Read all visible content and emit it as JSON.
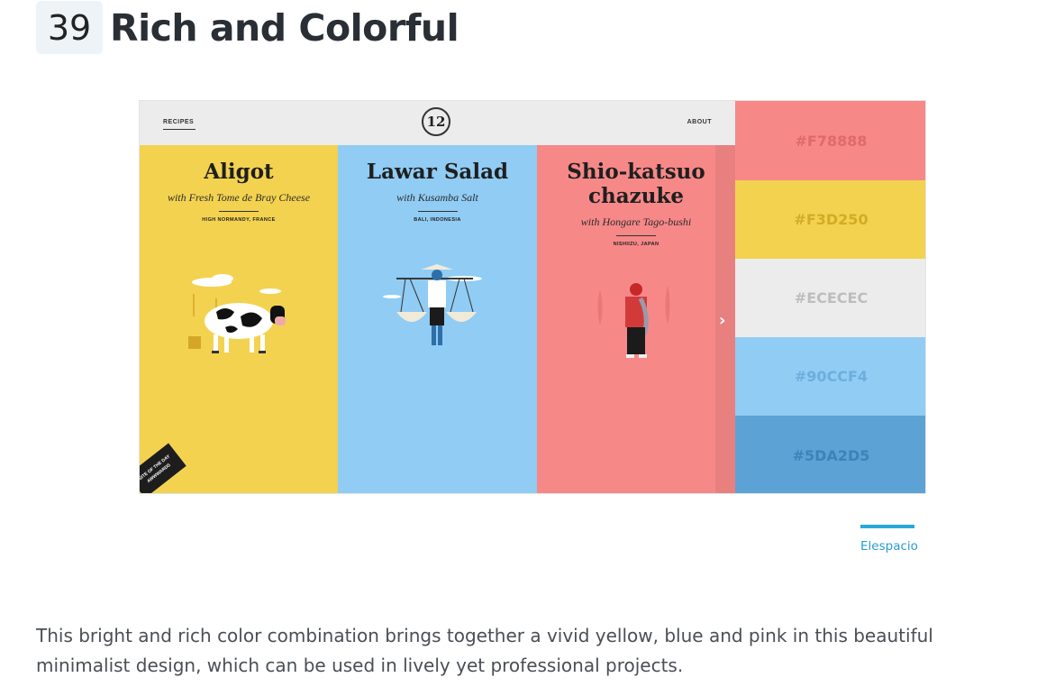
{
  "section": {
    "number": "39",
    "title": "Rich and Colorful"
  },
  "screenshot": {
    "nav": {
      "left": "RECIPES",
      "right": "ABOUT",
      "logo": "12"
    },
    "dishes": [
      {
        "title": "Aligot",
        "subtitle": "with Fresh Tome de Bray Cheese",
        "location": "HIGH NORMANDY, FRANCE",
        "color": "#F3D250"
      },
      {
        "title": "Lawar Salad",
        "subtitle": "with Kusamba Salt",
        "location": "BALI, INDONESIA",
        "color": "#90CCF4"
      },
      {
        "title_line1": "Shio-katsuo",
        "title_line2": "chazuke",
        "subtitle": "with Hongare Tago-bushi",
        "location": "NISHIIZU, JAPAN",
        "color": "#F78888"
      }
    ],
    "next_arrow": "›",
    "award_badge": {
      "line1": "SITE OF THE DAY",
      "line2": "AWWWARDS"
    }
  },
  "palette": [
    {
      "hex": "#F78888",
      "text_color": "#e06a6a"
    },
    {
      "hex": "#F3D250",
      "text_color": "#d1ad27"
    },
    {
      "hex": "#ECECEC",
      "text_color": "#bdbdbd"
    },
    {
      "hex": "#90CCF4",
      "text_color": "#6eaedc"
    },
    {
      "hex": "#5DA2D5",
      "text_color": "#3e82b7"
    }
  ],
  "credit": {
    "label": "Elespacio"
  },
  "description": "This bright and rich color combination brings together a vivid yellow, blue and pink in this beautiful minimalist design, which can be used in lively yet professional projects."
}
